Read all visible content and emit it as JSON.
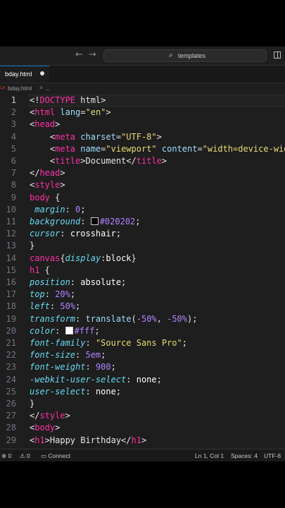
{
  "titlebar": {
    "back_glyph": "←",
    "forward_glyph": "→",
    "search_glyph": "⌕",
    "command_center_label": "templates"
  },
  "tab": {
    "label": "bday.html",
    "dirty": true
  },
  "breadcrumb": {
    "file": "bday.html",
    "sep": ">",
    "more": "..."
  },
  "editor": {
    "active_line": 1,
    "lines": [
      {
        "n": "1",
        "tokens": [
          {
            "t": "<!",
            "c": "punct"
          },
          {
            "t": "DOCTYPE",
            "c": "pink"
          },
          {
            "t": " html>",
            "c": "punct"
          }
        ]
      },
      {
        "n": "2",
        "tokens": [
          {
            "t": "<",
            "c": "punct"
          },
          {
            "t": "html",
            "c": "kw"
          },
          {
            "t": " lang",
            "c": "attr"
          },
          {
            "t": "=",
            "c": "punct"
          },
          {
            "t": "\"en\"",
            "c": "str"
          },
          {
            "t": ">",
            "c": "punct"
          }
        ]
      },
      {
        "n": "3",
        "tokens": [
          {
            "t": "<",
            "c": "punct"
          },
          {
            "t": "head",
            "c": "kw"
          },
          {
            "t": ">",
            "c": "punct"
          }
        ]
      },
      {
        "n": "4",
        "tokens": [
          {
            "t": "    <",
            "c": "punct"
          },
          {
            "t": "meta",
            "c": "kw"
          },
          {
            "t": " charset",
            "c": "attr"
          },
          {
            "t": "=",
            "c": "punct"
          },
          {
            "t": "\"UTF-8\"",
            "c": "str"
          },
          {
            "t": ">",
            "c": "punct"
          }
        ]
      },
      {
        "n": "5",
        "tokens": [
          {
            "t": "    <",
            "c": "punct"
          },
          {
            "t": "meta",
            "c": "kw"
          },
          {
            "t": " name",
            "c": "attr"
          },
          {
            "t": "=",
            "c": "punct"
          },
          {
            "t": "\"viewport\"",
            "c": "str"
          },
          {
            "t": " content",
            "c": "attr"
          },
          {
            "t": "=",
            "c": "punct"
          },
          {
            "t": "\"width=device-wid",
            "c": "str"
          }
        ]
      },
      {
        "n": "6",
        "tokens": [
          {
            "t": "    <",
            "c": "punct"
          },
          {
            "t": "title",
            "c": "kw"
          },
          {
            "t": ">Document</",
            "c": "punct"
          },
          {
            "t": "title",
            "c": "kw"
          },
          {
            "t": ">",
            "c": "punct"
          }
        ]
      },
      {
        "n": "7",
        "tokens": [
          {
            "t": "</",
            "c": "punct"
          },
          {
            "t": "head",
            "c": "kw"
          },
          {
            "t": ">",
            "c": "punct"
          }
        ]
      },
      {
        "n": "8",
        "tokens": [
          {
            "t": "<",
            "c": "punct"
          },
          {
            "t": "style",
            "c": "kw"
          },
          {
            "t": ">",
            "c": "punct"
          }
        ]
      },
      {
        "n": "9",
        "tokens": [
          {
            "t": "body",
            "c": "kw"
          },
          {
            "t": " {",
            "c": "punct"
          }
        ]
      },
      {
        "n": "10",
        "tokens": [
          {
            "t": " margin",
            "c": "prop"
          },
          {
            "t": ": ",
            "c": "punct"
          },
          {
            "t": "0",
            "c": "num"
          },
          {
            "t": ";",
            "c": "punct"
          }
        ]
      },
      {
        "n": "11",
        "tokens": [
          {
            "t": "background",
            "c": "prop"
          },
          {
            "t": ": ",
            "c": "punct"
          },
          {
            "t": "",
            "c": "swatch",
            "color": "#020202"
          },
          {
            "t": "#020202",
            "c": "num"
          },
          {
            "t": ";",
            "c": "punct"
          }
        ]
      },
      {
        "n": "12",
        "tokens": [
          {
            "t": "cursor",
            "c": "prop"
          },
          {
            "t": ": ",
            "c": "punct"
          },
          {
            "t": "crosshair",
            "c": "val"
          },
          {
            "t": ";",
            "c": "punct"
          }
        ]
      },
      {
        "n": "13",
        "tokens": [
          {
            "t": "}",
            "c": "punct"
          }
        ]
      },
      {
        "n": "14",
        "tokens": [
          {
            "t": "canvas",
            "c": "kw"
          },
          {
            "t": "{",
            "c": "punct"
          },
          {
            "t": "display",
            "c": "prop"
          },
          {
            "t": ":",
            "c": "punct"
          },
          {
            "t": "block",
            "c": "val"
          },
          {
            "t": "}",
            "c": "punct"
          }
        ]
      },
      {
        "n": "15",
        "tokens": [
          {
            "t": "h1",
            "c": "kw"
          },
          {
            "t": " {",
            "c": "punct"
          }
        ]
      },
      {
        "n": "16",
        "tokens": [
          {
            "t": "position",
            "c": "prop"
          },
          {
            "t": ": ",
            "c": "punct"
          },
          {
            "t": "absolute",
            "c": "val"
          },
          {
            "t": ";",
            "c": "punct"
          }
        ]
      },
      {
        "n": "17",
        "tokens": [
          {
            "t": "top",
            "c": "prop"
          },
          {
            "t": ": ",
            "c": "punct"
          },
          {
            "t": "20%",
            "c": "num"
          },
          {
            "t": ";",
            "c": "punct"
          }
        ]
      },
      {
        "n": "18",
        "tokens": [
          {
            "t": "left",
            "c": "prop"
          },
          {
            "t": ": ",
            "c": "punct"
          },
          {
            "t": "50%",
            "c": "num"
          },
          {
            "t": ";",
            "c": "punct"
          }
        ]
      },
      {
        "n": "19",
        "tokens": [
          {
            "t": "transform",
            "c": "prop"
          },
          {
            "t": ": ",
            "c": "punct"
          },
          {
            "t": "translate",
            "c": "attr"
          },
          {
            "t": "(",
            "c": "punct"
          },
          {
            "t": "-50%",
            "c": "num"
          },
          {
            "t": ", ",
            "c": "punct"
          },
          {
            "t": "-50%",
            "c": "num"
          },
          {
            "t": ");",
            "c": "punct"
          }
        ]
      },
      {
        "n": "20",
        "tokens": [
          {
            "t": "color",
            "c": "prop"
          },
          {
            "t": ": ",
            "c": "punct"
          },
          {
            "t": "",
            "c": "swatch",
            "color": "#ffffff"
          },
          {
            "t": "#fff",
            "c": "num"
          },
          {
            "t": ";",
            "c": "punct"
          }
        ]
      },
      {
        "n": "21",
        "tokens": [
          {
            "t": "font-family",
            "c": "prop"
          },
          {
            "t": ": ",
            "c": "punct"
          },
          {
            "t": "\"Source Sans Pro\"",
            "c": "str"
          },
          {
            "t": ";",
            "c": "punct"
          }
        ]
      },
      {
        "n": "22",
        "tokens": [
          {
            "t": "font-size",
            "c": "prop"
          },
          {
            "t": ": ",
            "c": "punct"
          },
          {
            "t": "5em",
            "c": "num"
          },
          {
            "t": ";",
            "c": "punct"
          }
        ]
      },
      {
        "n": "23",
        "tokens": [
          {
            "t": "font-weight",
            "c": "prop"
          },
          {
            "t": ": ",
            "c": "punct"
          },
          {
            "t": "900",
            "c": "num"
          },
          {
            "t": ";",
            "c": "punct"
          }
        ]
      },
      {
        "n": "24",
        "tokens": [
          {
            "t": "-webkit-user-select",
            "c": "prop"
          },
          {
            "t": ": ",
            "c": "punct"
          },
          {
            "t": "none",
            "c": "val"
          },
          {
            "t": ";",
            "c": "punct"
          }
        ]
      },
      {
        "n": "25",
        "tokens": [
          {
            "t": "user-select",
            "c": "prop"
          },
          {
            "t": ": ",
            "c": "punct"
          },
          {
            "t": "none",
            "c": "val"
          },
          {
            "t": ";",
            "c": "punct"
          }
        ]
      },
      {
        "n": "26",
        "tokens": [
          {
            "t": "}",
            "c": "punct"
          }
        ]
      },
      {
        "n": "27",
        "tokens": [
          {
            "t": "</",
            "c": "punct"
          },
          {
            "t": "style",
            "c": "kw"
          },
          {
            "t": ">",
            "c": "punct"
          }
        ]
      },
      {
        "n": "28",
        "tokens": [
          {
            "t": "<",
            "c": "punct"
          },
          {
            "t": "body",
            "c": "kw"
          },
          {
            "t": ">",
            "c": "punct"
          }
        ]
      },
      {
        "n": "29",
        "tokens": [
          {
            "t": "<",
            "c": "punct"
          },
          {
            "t": "h1",
            "c": "kw"
          },
          {
            "t": ">Happy Birthday</",
            "c": "punct"
          },
          {
            "t": "h1",
            "c": "kw"
          },
          {
            "t": ">",
            "c": "punct"
          }
        ]
      }
    ]
  },
  "statusbar": {
    "errors": "⊗ 0",
    "warnings": "⚠ 0",
    "connect": "Connect",
    "cursor_pos": "Ln 1, Col 1",
    "spaces": "Spaces: 4",
    "encoding": "UTF-8"
  },
  "colors": {
    "accent": "#0078d4",
    "editor_bg": "#1e1e1e",
    "tag": "#ff2fa6",
    "string": "#e6db74",
    "number": "#ae81ff",
    "property": "#66d9ef"
  }
}
